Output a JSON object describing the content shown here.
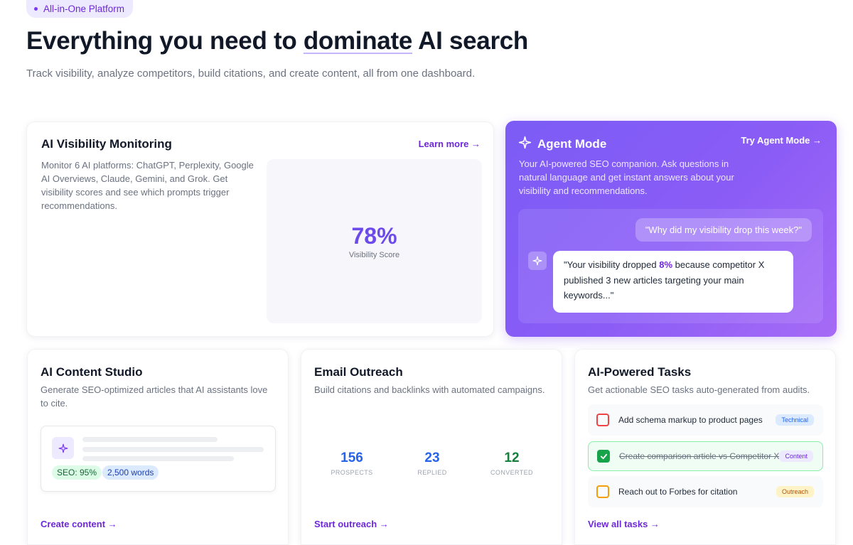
{
  "hero": {
    "badge": "All-in-One Platform",
    "title_pre": "Everything you need to ",
    "title_highlight": "dominate",
    "title_post": " AI search",
    "subtitle": "Track visibility, analyze competitors, build citations, and create content, all from one dashboard."
  },
  "visibility": {
    "title": "AI Visibility Monitoring",
    "link": "Learn more →",
    "description": "Monitor 6 AI platforms: ChatGPT, Perplexity, Google AI Overviews, Claude, Gemini, and Grok. Get visibility scores and see which prompts trigger recommendations.",
    "score": "78%",
    "score_label": "Visibility Score"
  },
  "agent": {
    "title": "Agent Mode",
    "link": "Try Agent Mode →",
    "description": "Your AI-powered SEO companion. Ask questions in natural language and get instant answers about your visibility and recommendations.",
    "user_message": "\"Why did my visibility drop this week?\"",
    "reply_pre": "\"Your visibility dropped ",
    "reply_highlight": "8%",
    "reply_post": " because competitor X published 3 new articles targeting your main keywords...\""
  },
  "content_studio": {
    "title": "AI Content Studio",
    "description": "Generate SEO-optimized articles that AI assistants love to cite.",
    "seo_tag": "SEO: 95%",
    "words_tag": "2,500 words",
    "link": "Create content →"
  },
  "outreach": {
    "title": "Email Outreach",
    "description": "Build citations and backlinks with automated campaigns.",
    "stats": [
      {
        "value": "156",
        "label": "PROSPECTS",
        "color": "#2563eb"
      },
      {
        "value": "23",
        "label": "REPLIED",
        "color": "#2563eb"
      },
      {
        "value": "12",
        "label": "CONVERTED",
        "color": "#15803d"
      }
    ],
    "link": "Start outreach →"
  },
  "tasks": {
    "title": "AI-Powered Tasks",
    "description": "Get actionable SEO tasks auto-generated from audits.",
    "items": [
      {
        "text": "Add schema markup to product pages",
        "tag": "Technical",
        "done": false,
        "check_color": "#ef4444",
        "tag_bg": "#dbeafe",
        "tag_color": "#2563eb"
      },
      {
        "text": "Create comparison article vs Competitor X",
        "tag": "Content",
        "done": true,
        "check_color": "#16a34a",
        "tag_bg": "#ede9fe",
        "tag_color": "#6d28d9"
      },
      {
        "text": "Reach out to Forbes for citation",
        "tag": "Outreach",
        "done": false,
        "check_color": "#f59e0b",
        "tag_bg": "#fef3c7",
        "tag_color": "#b45309"
      }
    ],
    "link": "View all tasks →"
  },
  "icons": {
    "sparkle": "sparkle-icon",
    "check": "check-icon"
  },
  "colors": {
    "accent": "#6d28d9",
    "agent_gradient_start": "#7b5cf5",
    "agent_gradient_end": "#a66bf6"
  }
}
